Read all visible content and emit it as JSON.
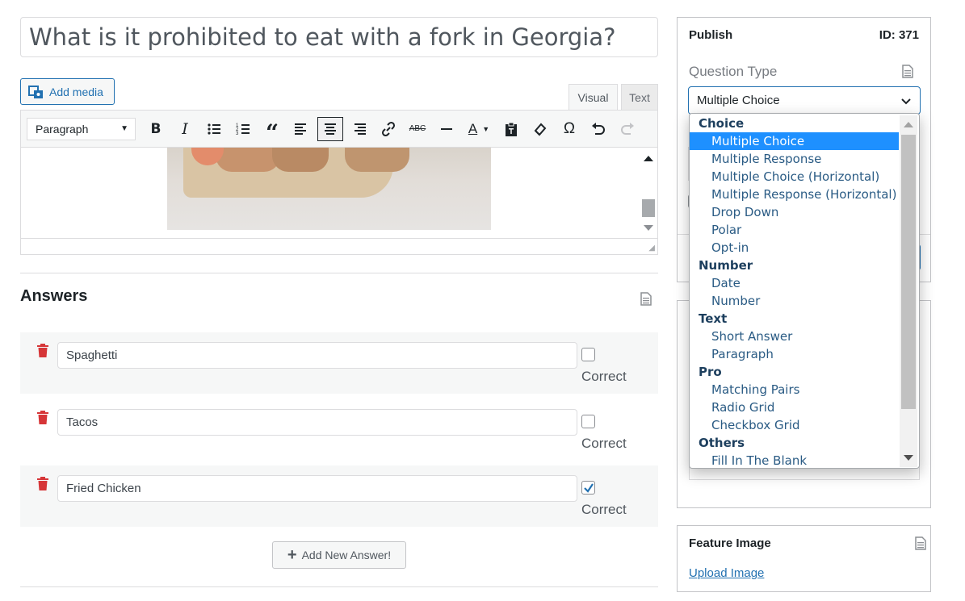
{
  "post": {
    "title": "What is it prohibited to eat with a fork in Georgia?"
  },
  "editor": {
    "add_media_label": "Add media",
    "tabs": [
      "Visual",
      "Text"
    ],
    "format_select": "Paragraph"
  },
  "answers": {
    "heading": "Answers",
    "correct_label": "Correct",
    "items": [
      {
        "value": "Spaghetti",
        "correct": false
      },
      {
        "value": "Tacos",
        "correct": false
      },
      {
        "value": "Fried Chicken",
        "correct": true
      }
    ],
    "add_button": "Add New Answer!"
  },
  "publish": {
    "title": "Publish",
    "id_label": "ID: 371",
    "question_type_label": "Question Type",
    "question_type_value": "Multiple Choice"
  },
  "dropdown": {
    "groups": [
      {
        "label": "Choice",
        "options": [
          "Multiple Choice",
          "Multiple Response",
          "Multiple Choice (Horizontal)",
          "Multiple Response (Horizontal)",
          "Drop Down",
          "Polar",
          "Opt-in"
        ]
      },
      {
        "label": "Number",
        "options": [
          "Date",
          "Number"
        ]
      },
      {
        "label": "Text",
        "options": [
          "Short Answer",
          "Paragraph"
        ]
      },
      {
        "label": "Pro",
        "options": [
          "Matching Pairs",
          "Radio Grid",
          "Checkbox Grid"
        ]
      },
      {
        "label": "Others",
        "options": [
          "Fill In The Blank"
        ]
      }
    ],
    "selected": "Multiple Choice"
  },
  "feature_image": {
    "title": "Feature Image",
    "upload_link": "Upload Image"
  },
  "colors": {
    "accent": "#2271b1",
    "selected_option": "#1e90ff",
    "trash": "#d63638"
  }
}
